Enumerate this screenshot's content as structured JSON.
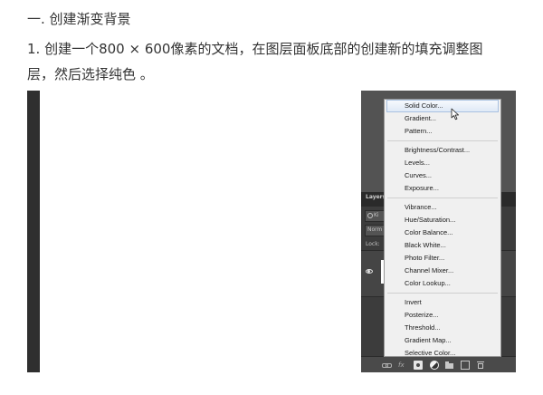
{
  "article": {
    "heading": "一. 创建渐变背景",
    "step_line1": "1. 创建一个800 × 600像素的文档，在图层面板底部的创建新的填充调整图",
    "step_line2": "层，然后选择纯色 。"
  },
  "layers_panel": {
    "tab_label": "Layers",
    "kind_filter": "Ki",
    "blend_mode": "Norm",
    "lock_label": "Lock:"
  },
  "menu_groups": [
    {
      "items": [
        "Solid Color...",
        "Gradient...",
        "Pattern..."
      ]
    },
    {
      "items": [
        "Brightness/Contrast...",
        "Levels...",
        "Curves...",
        "Exposure..."
      ]
    },
    {
      "items": [
        "Vibrance...",
        "Hue/Saturation...",
        "Color Balance...",
        "Black  White...",
        "Photo Filter...",
        "Channel Mixer...",
        "Color Lookup..."
      ]
    },
    {
      "items": [
        "Invert",
        "Posterize...",
        "Threshold...",
        "Gradient Map...",
        "Selective Color..."
      ]
    }
  ],
  "highlighted_item": "Solid Color...",
  "bottom_bar_icons": [
    "link-icon",
    "fx-icon",
    "mask-icon",
    "adjust-icon",
    "folder-icon",
    "new-layer-icon",
    "trash-icon"
  ],
  "colors": {
    "panel_bg": "#535353",
    "menu_bg": "#f0f0f0",
    "highlight_border": "#a8c1e1"
  }
}
